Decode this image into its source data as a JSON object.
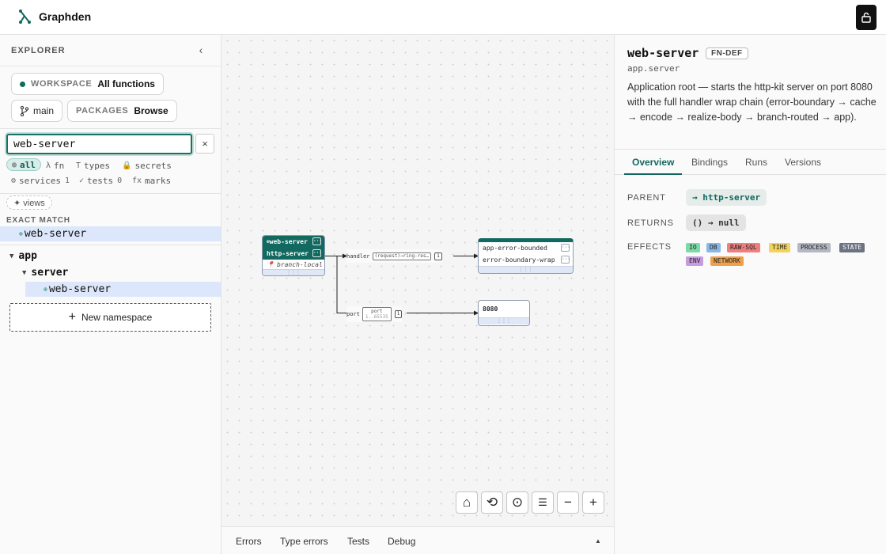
{
  "app": {
    "name": "Graphden"
  },
  "colors": {
    "accent": "#12695f",
    "highlight": "#dde7fb"
  },
  "explorer": {
    "title": "EXPLORER",
    "workspace": {
      "key": "WORKSPACE",
      "value": "All functions"
    },
    "branch": "main",
    "packages": {
      "key": "PACKAGES",
      "value": "Browse"
    },
    "search": {
      "value": "web-server",
      "clear": "×"
    },
    "filters": [
      {
        "icon": "◍",
        "label": "all",
        "count": ""
      },
      {
        "icon": "λ",
        "label": "fn",
        "count": ""
      },
      {
        "icon": "T",
        "label": "types",
        "count": ""
      },
      {
        "icon": "🔒",
        "label": "secrets",
        "count": ""
      },
      {
        "icon": "⚙",
        "label": "services",
        "count": "1"
      },
      {
        "icon": "✓",
        "label": "tests",
        "count": "0"
      },
      {
        "icon": "fx",
        "label": "marks",
        "count": ""
      }
    ],
    "views": "✦ views",
    "exact_match_label": "EXACT MATCH",
    "exact_match_item": "web-server",
    "tree": {
      "root": "app",
      "child": "server",
      "leaf": "web-server"
    },
    "new_namespace": "New namespace"
  },
  "graph": {
    "root_node": {
      "name": "web-server",
      "dep": "http-server",
      "meta": "branch-local"
    },
    "edge_handler": {
      "label": "handler",
      "type": "(request)→ring-res…",
      "count": "1"
    },
    "edge_port": {
      "label": "port",
      "type": "port",
      "range": "1..65535",
      "count": "1"
    },
    "wrap_node": {
      "rows": [
        "app-error-bounded",
        "error-boundary-wrap"
      ]
    },
    "port_node": {
      "value": "8080"
    }
  },
  "bottom_tabs": [
    "Errors",
    "Type errors",
    "Tests",
    "Debug"
  ],
  "detail": {
    "title": "web-server",
    "badge": "FN-DEF",
    "namespace": "app.server",
    "description": "Application root — starts the http-kit server on port 8080 with the full handler wrap chain (error-boundary → cache → encode → realize-body → branch-routed → app).",
    "tabs": [
      "Overview",
      "Bindings",
      "Runs",
      "Versions"
    ],
    "parent": {
      "key": "PARENT",
      "value": "→ http-server"
    },
    "returns": {
      "key": "RETURNS",
      "value": "() → null"
    },
    "effects": {
      "key": "EFFECTS",
      "items": [
        {
          "label": "IO",
          "color": "#7ed9a6"
        },
        {
          "label": "DB",
          "color": "#8ab8e6"
        },
        {
          "label": "RAW-SQL",
          "color": "#ef7f7f"
        },
        {
          "label": "TIME",
          "color": "#f3d35b"
        },
        {
          "label": "PROCESS",
          "color": "#b4b8c2"
        },
        {
          "label": "STATE",
          "color": "#6b7280"
        },
        {
          "label": "ENV",
          "color": "#c79be0"
        },
        {
          "label": "NETWORK",
          "color": "#f0a04b"
        }
      ]
    }
  }
}
